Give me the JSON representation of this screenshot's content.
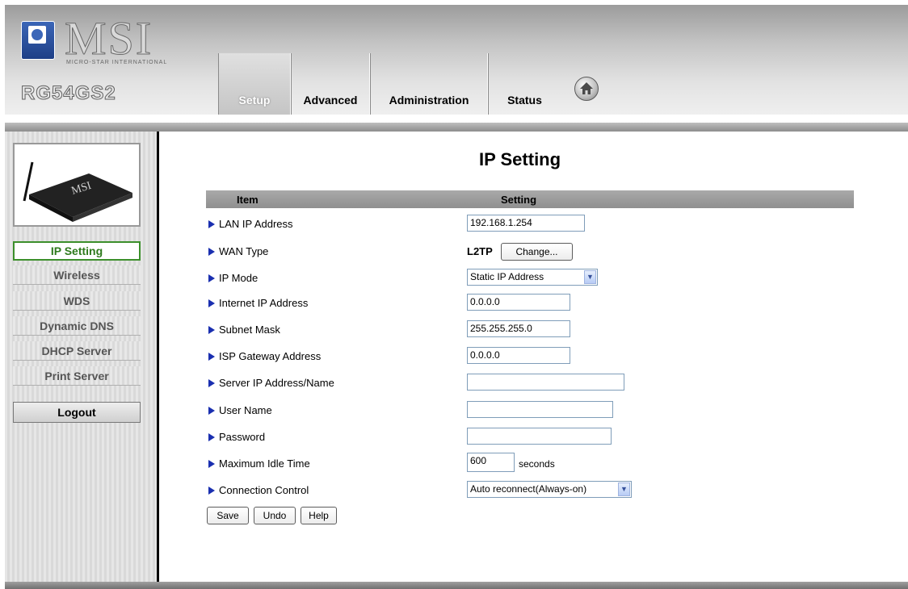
{
  "header": {
    "brand": "MSI",
    "brand_subtitle": "MICRO-STAR INTERNATIONAL",
    "model": "RG54GS2",
    "tabs": [
      {
        "label": "Setup",
        "active": true
      },
      {
        "label": "Advanced",
        "active": false
      },
      {
        "label": "Administration",
        "active": false
      },
      {
        "label": "Status",
        "active": false
      }
    ],
    "home_icon": "home-icon"
  },
  "sidebar": {
    "router_image_label": "MSI",
    "items": [
      {
        "label": "IP Setting",
        "active": true
      },
      {
        "label": "Wireless",
        "active": false
      },
      {
        "label": "WDS",
        "active": false
      },
      {
        "label": "Dynamic DNS",
        "active": false
      },
      {
        "label": "DHCP Server",
        "active": false
      },
      {
        "label": "Print Server",
        "active": false
      }
    ],
    "logout_label": "Logout"
  },
  "main": {
    "title": "IP Setting",
    "table_headers": {
      "item": "Item",
      "setting": "Setting"
    },
    "rows": {
      "lan_ip": {
        "label": "LAN IP Address",
        "value": "192.168.1.254"
      },
      "wan_type": {
        "label": "WAN Type",
        "value": "L2TP",
        "button": "Change..."
      },
      "ip_mode": {
        "label": "IP Mode",
        "value": "Static IP Address"
      },
      "internet_ip": {
        "label": "Internet IP Address",
        "value": "0.0.0.0"
      },
      "subnet_mask": {
        "label": "Subnet Mask",
        "value": "255.255.255.0"
      },
      "isp_gateway": {
        "label": "ISP Gateway Address",
        "value": "0.0.0.0"
      },
      "server_ip": {
        "label": "Server IP Address/Name",
        "value": ""
      },
      "user_name": {
        "label": "User Name",
        "value": ""
      },
      "password": {
        "label": "Password",
        "value": ""
      },
      "max_idle": {
        "label": "Maximum Idle Time",
        "value": "600",
        "unit": "seconds"
      },
      "connection_control": {
        "label": "Connection Control",
        "value": "Auto reconnect(Always-on)"
      }
    },
    "buttons": {
      "save": "Save",
      "undo": "Undo",
      "help": "Help"
    }
  },
  "colors": {
    "active_nav_border": "#3c8f2b",
    "bullet": "#1a2fb0",
    "table_header": "#9d9d9d"
  }
}
